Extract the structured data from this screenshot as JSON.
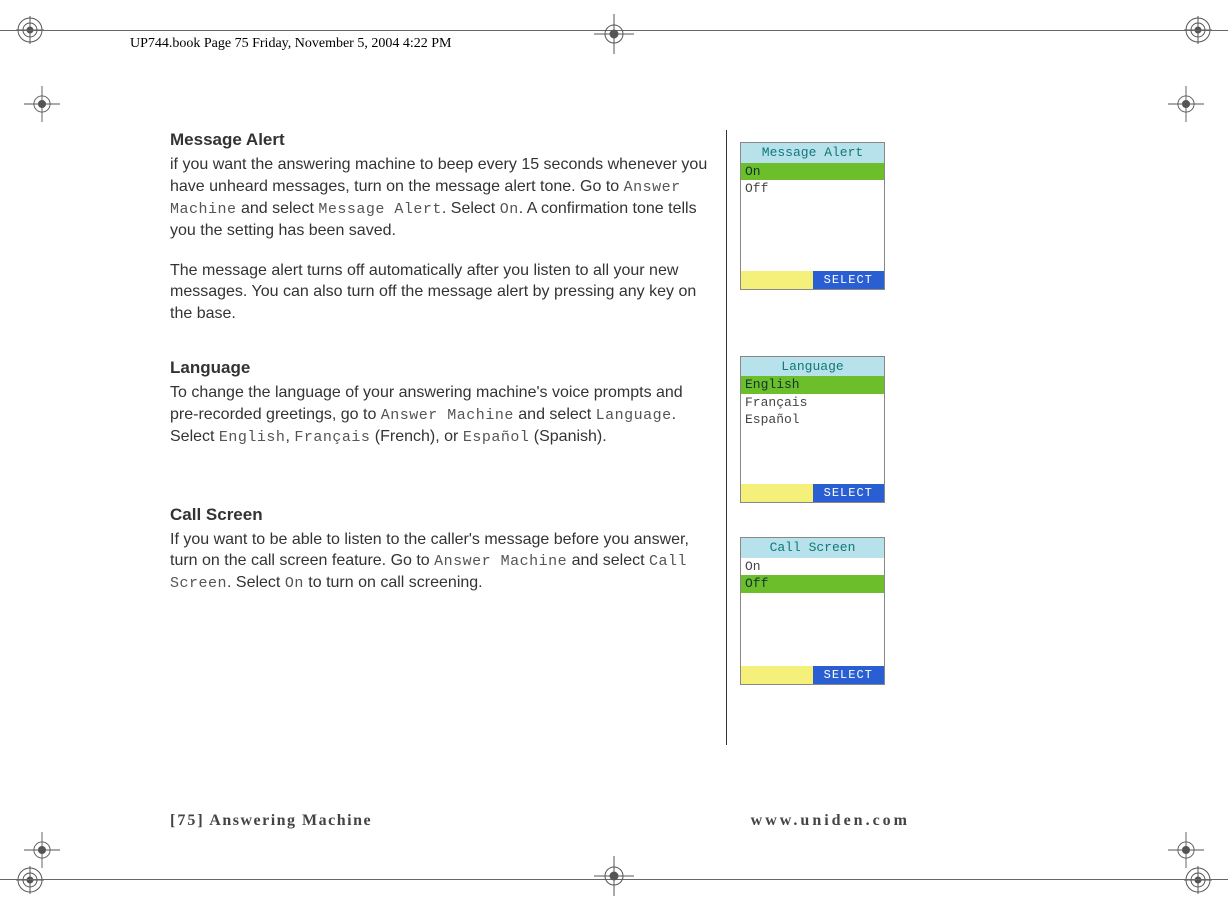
{
  "header": {
    "stamp": "UP744.book  Page 75  Friday, November 5, 2004  4:22 PM"
  },
  "sections": {
    "messageAlert": {
      "heading": "Message Alert",
      "p1a": "if you want the answering machine to beep every 15 seconds whenever you have unheard messages, turn on the message alert tone. Go to ",
      "p1_lcd1": "Answer Machine",
      "p1b": " and select ",
      "p1_lcd2": "Message Alert",
      "p1c": ". Select ",
      "p1_lcd3": "On",
      "p1d": ". A confirmation tone tells you the setting has been saved.",
      "p2": "The message alert turns off automatically after you listen to all your new messages. You can also turn off the message alert by pressing any key on the base."
    },
    "language": {
      "heading": "Language",
      "p1a": "To change the language of your answering machine's voice prompts and pre-recorded greetings, go to ",
      "p1_lcd1": "Answer Machine",
      "p1b": " and select ",
      "p1_lcd2": "Language",
      "p1c": ". Select ",
      "p1_lcd3": "English",
      "p1d": ", ",
      "p1_lcd4": "Français",
      "p1e": " (French), or ",
      "p1_lcd5": "Español",
      "p1f": " (Spanish)."
    },
    "callScreen": {
      "heading": "Call Screen",
      "p1a": "If you want to be able to listen to the caller's message before you answer, turn on the call screen feature. Go to ",
      "p1_lcd1": "Answer Machine",
      "p1b": " and select ",
      "p1_lcd2": "Call Screen",
      "p1c": ". Select ",
      "p1_lcd3": "On",
      "p1d": " to turn on call screening."
    }
  },
  "screens": {
    "s1": {
      "title": "Message Alert",
      "opt1": "On",
      "opt2": "Off",
      "button": "SELECT"
    },
    "s2": {
      "title": "Language",
      "opt1": "English",
      "opt2": "Français",
      "opt3": "Español",
      "button": "SELECT"
    },
    "s3": {
      "title": "Call Screen",
      "opt1": "On",
      "opt2": "Off",
      "button": "SELECT"
    }
  },
  "footer": {
    "left_page": "[75]",
    "left_title": " Answering Machine",
    "right": "www.uniden.com"
  }
}
